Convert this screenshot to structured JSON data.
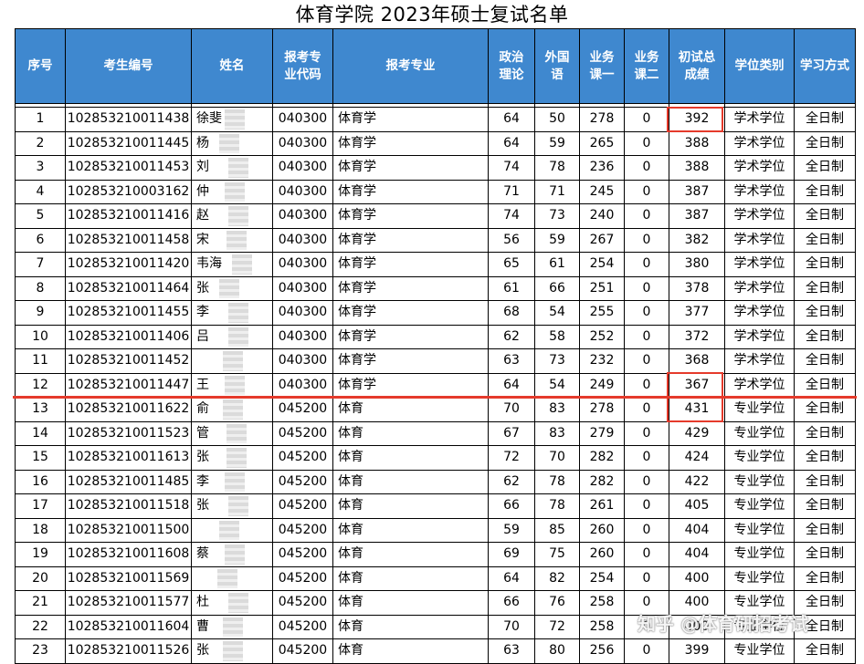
{
  "title": "体育学院  2023年硕士复试名单",
  "headers": [
    "序号",
    "考生编号",
    "姓名",
    "报考专业代码",
    "报考专业",
    "政治理论",
    "外国语",
    "业务课一",
    "业务课二",
    "初试总成绩",
    "学位类别",
    "学习方式"
  ],
  "header_lines": [
    [
      "序号"
    ],
    [
      "考生编号"
    ],
    [
      "姓名"
    ],
    [
      "报考专",
      "业代码"
    ],
    [
      "报考专业"
    ],
    [
      "政治",
      "理论"
    ],
    [
      "外国",
      "语"
    ],
    [
      "业务",
      "课一"
    ],
    [
      "业务",
      "课二"
    ],
    [
      "初试总",
      "成绩"
    ],
    [
      "学位类别"
    ],
    [
      "学习方式"
    ]
  ],
  "rows": [
    [
      "1",
      "102853210011438",
      "徐斐",
      "040300",
      "体育学",
      "64",
      "50",
      "278",
      "0",
      "392",
      "学术学位",
      "全日制"
    ],
    [
      "2",
      "102853210011445",
      "杨",
      "040300",
      "体育学",
      "64",
      "59",
      "265",
      "0",
      "388",
      "学术学位",
      "全日制"
    ],
    [
      "3",
      "102853210011453",
      "刘",
      "040300",
      "体育学",
      "74",
      "78",
      "236",
      "0",
      "388",
      "学术学位",
      "全日制"
    ],
    [
      "4",
      "102853210003162",
      "仲",
      "040300",
      "体育学",
      "71",
      "71",
      "245",
      "0",
      "387",
      "学术学位",
      "全日制"
    ],
    [
      "5",
      "102853210011416",
      "赵",
      "040300",
      "体育学",
      "74",
      "73",
      "240",
      "0",
      "387",
      "学术学位",
      "全日制"
    ],
    [
      "6",
      "102853210011458",
      "宋",
      "040300",
      "体育学",
      "56",
      "59",
      "267",
      "0",
      "382",
      "学术学位",
      "全日制"
    ],
    [
      "7",
      "102853210011420",
      "韦海",
      "040300",
      "体育学",
      "65",
      "61",
      "254",
      "0",
      "380",
      "学术学位",
      "全日制"
    ],
    [
      "8",
      "102853210011464",
      "张",
      "040300",
      "体育学",
      "61",
      "66",
      "251",
      "0",
      "378",
      "学术学位",
      "全日制"
    ],
    [
      "9",
      "102853210011455",
      "李",
      "040300",
      "体育学",
      "68",
      "54",
      "255",
      "0",
      "377",
      "学术学位",
      "全日制"
    ],
    [
      "10",
      "102853210011406",
      "吕",
      "040300",
      "体育学",
      "62",
      "58",
      "252",
      "0",
      "372",
      "学术学位",
      "全日制"
    ],
    [
      "11",
      "102853210011452",
      "",
      "040300",
      "体育学",
      "63",
      "73",
      "232",
      "0",
      "368",
      "学术学位",
      "全日制"
    ],
    [
      "12",
      "102853210011447",
      "王",
      "040300",
      "体育学",
      "64",
      "54",
      "249",
      "0",
      "367",
      "学术学位",
      "全日制"
    ],
    [
      "13",
      "102853210011622",
      "俞",
      "045200",
      "体育",
      "70",
      "83",
      "278",
      "0",
      "431",
      "专业学位",
      "全日制"
    ],
    [
      "14",
      "102853210011523",
      "管",
      "045200",
      "体育",
      "67",
      "83",
      "279",
      "0",
      "429",
      "专业学位",
      "全日制"
    ],
    [
      "15",
      "102853210011613",
      "张",
      "045200",
      "体育",
      "72",
      "70",
      "282",
      "0",
      "424",
      "专业学位",
      "全日制"
    ],
    [
      "16",
      "102853210011485",
      "李",
      "045200",
      "体育",
      "62",
      "78",
      "282",
      "0",
      "422",
      "专业学位",
      "全日制"
    ],
    [
      "17",
      "102853210011518",
      "张",
      "045200",
      "体育",
      "66",
      "78",
      "261",
      "0",
      "405",
      "专业学位",
      "全日制"
    ],
    [
      "18",
      "102853210011500",
      "",
      "045200",
      "体育",
      "59",
      "85",
      "260",
      "0",
      "404",
      "专业学位",
      "全日制"
    ],
    [
      "19",
      "102853210011608",
      "蔡",
      "045200",
      "体育",
      "69",
      "75",
      "260",
      "0",
      "404",
      "专业学位",
      "全日制"
    ],
    [
      "20",
      "102853210011569",
      "",
      "045200",
      "体育",
      "64",
      "82",
      "254",
      "0",
      "400",
      "专业学位",
      "全日制"
    ],
    [
      "21",
      "102853210011577",
      "杜",
      "045200",
      "体育",
      "66",
      "76",
      "258",
      "0",
      "400",
      "专业学位",
      "全日制"
    ],
    [
      "22",
      "102853210011604",
      "曹",
      "045200",
      "体育",
      "70",
      "72",
      "258",
      "0",
      "400",
      "专业学位",
      "全日制"
    ],
    [
      "23",
      "102853210011526",
      "张",
      "045200",
      "体育",
      "63",
      "80",
      "256",
      "0",
      "399",
      "专业学位",
      "全日制"
    ]
  ],
  "highlight_color": "#e53a2b",
  "header_color": "#3f88cf",
  "highlighted_scores": [
    "392",
    "367",
    "431"
  ],
  "watermark": "知乎 @体育研招考试"
}
